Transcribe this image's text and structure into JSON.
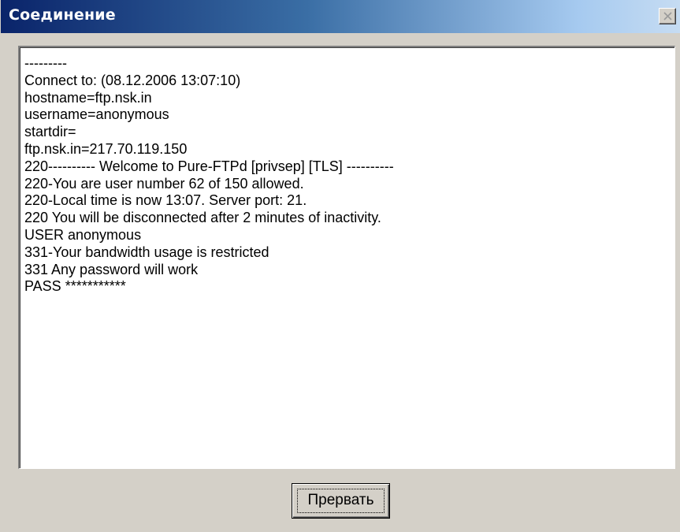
{
  "window": {
    "title": "Соединение",
    "close_icon": "close-icon"
  },
  "log": {
    "lines": [
      "---------",
      "Connect to: (08.12.2006 13:07:10)",
      "hostname=ftp.nsk.in",
      "username=anonymous",
      "startdir=",
      "ftp.nsk.in=217.70.119.150",
      "220---------- Welcome to Pure-FTPd [privsep] [TLS] ----------",
      "220-You are user number 62 of 150 allowed.",
      "220-Local time is now 13:07. Server port: 21.",
      "220 You will be disconnected after 2 minutes of inactivity.",
      "USER anonymous",
      "331-Your bandwidth usage is restricted",
      "331 Any password will work",
      "PASS ***********"
    ]
  },
  "buttons": {
    "abort_label": "Прервать"
  }
}
